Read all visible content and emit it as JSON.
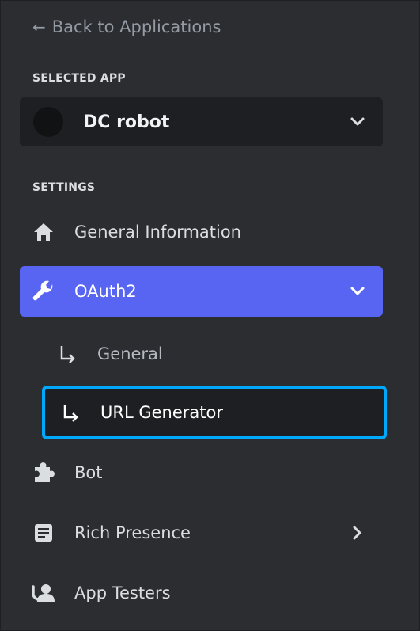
{
  "back_link": {
    "arrow": "←",
    "label": "Back to Applications"
  },
  "selected_app": {
    "section_label": "SELECTED APP",
    "name": "DC robot",
    "avatar_color": "#111214",
    "chevron_icon": "chevron-down-icon"
  },
  "settings": {
    "section_label": "SETTINGS",
    "items": [
      {
        "label": "General Information",
        "icon": "home-icon"
      },
      {
        "label": "OAuth2",
        "icon": "wrench-icon",
        "active": true,
        "expanded": true,
        "sub_items": [
          {
            "label": "General",
            "icon": "sub-arrow-icon"
          },
          {
            "label": "URL Generator",
            "icon": "sub-arrow-icon",
            "selected": true
          }
        ]
      },
      {
        "label": "Bot",
        "icon": "puzzle-icon"
      },
      {
        "label": "Rich Presence",
        "icon": "document-icon",
        "chevron": "chevron-right-icon"
      },
      {
        "label": "App Testers",
        "icon": "person-icon"
      }
    ]
  },
  "colors": {
    "background": "#2b2d31",
    "active_item": "#5865f2",
    "focus_ring": "#00a8fc",
    "text": "#dbdee1",
    "muted_text": "#949ba4"
  }
}
